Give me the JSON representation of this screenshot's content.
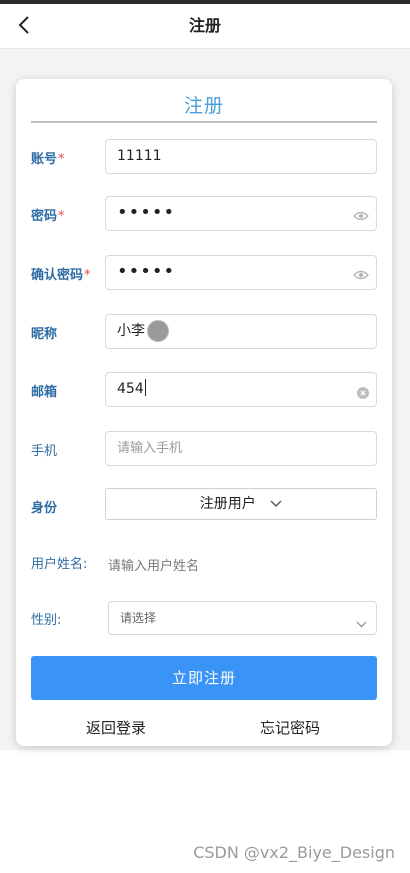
{
  "nav": {
    "title": "注册"
  },
  "form": {
    "heading": "注册",
    "account": {
      "label": "账号",
      "required": "*",
      "value": "11111"
    },
    "password": {
      "label": "密码",
      "required": "*",
      "value": "•••••"
    },
    "confirm_password": {
      "label": "确认密码",
      "required": "*",
      "value": "•••••"
    },
    "nickname": {
      "label": "昵称",
      "value": "小李"
    },
    "email": {
      "label": "邮箱",
      "value": "454"
    },
    "phone": {
      "label": "手机",
      "placeholder": "请输入手机"
    },
    "identity": {
      "label": "身份",
      "value": "注册用户"
    },
    "username": {
      "label": "用户姓名:",
      "placeholder": "请输入用户姓名"
    },
    "gender": {
      "label": "性别:",
      "placeholder": "请选择"
    },
    "submit_label": "立即注册",
    "back_login_label": "返回登录",
    "forgot_password_label": "忘记密码"
  },
  "watermark": "CSDN @vx2_Biye_Design",
  "colors": {
    "primary": "#3a93f7",
    "label": "#2e6da4",
    "heading": "#4a9fd8",
    "required": "#e14c4c"
  }
}
